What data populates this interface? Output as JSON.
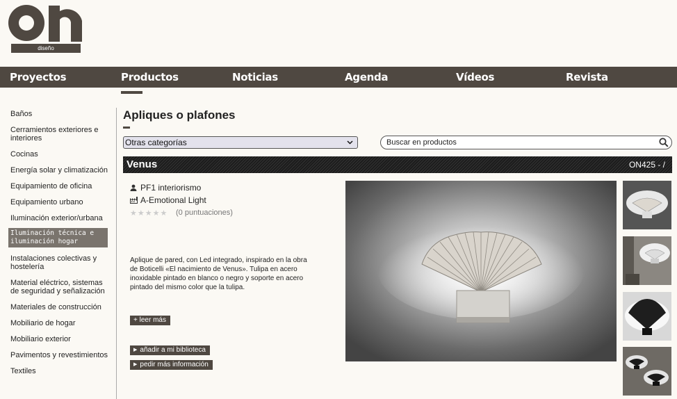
{
  "brand": {
    "logo_text": "on",
    "logo_sub": "diseño"
  },
  "nav": {
    "items": [
      "Proyectos",
      "Productos",
      "Noticias",
      "Agenda",
      "Vídeos",
      "Revista"
    ]
  },
  "sidebar": {
    "items": [
      "Baños",
      "Cerramientos exteriores e interiores",
      "Cocinas",
      "Energía solar y climatización",
      "Equipamiento de oficina",
      "Equipamiento urbano",
      "Iluminación exterior/urbana",
      "Iluminación técnica e iluminación hogar",
      "Instalaciones colectivas y hostelería",
      "Material eléctrico, sistemas de seguridad y señalización",
      "Materiales de construcción",
      "Mobiliario de hogar",
      "Mobiliario exterior",
      "Pavimentos y revestimientos",
      "Textiles"
    ]
  },
  "main": {
    "title": "Apliques o plafones",
    "category_select": "Otras categorías",
    "search_placeholder": "Buscar en productos"
  },
  "product": {
    "name": "Venus",
    "code": "ON425 - /",
    "designer": "PF1 interiorismo",
    "manufacturer": "A-Emotional Light",
    "ratings": "(0 puntuaciones)",
    "stars": "★★★★★",
    "description": "Aplique de pared, con Led integrado, inspirado en la obra de Boticelli «El nacimiento de Venus». Tulipa en acero inoxidable pintado en blanco o negro y soporte en acero pintado del mismo color que la tulipa.",
    "read_more": "+ leer más",
    "add_library": "añadir a mi biblioteca",
    "more_info": "pedir más información"
  },
  "colors": {
    "brand": "#4f4841",
    "background": "#fbf9f4",
    "active": "#7a746d"
  }
}
